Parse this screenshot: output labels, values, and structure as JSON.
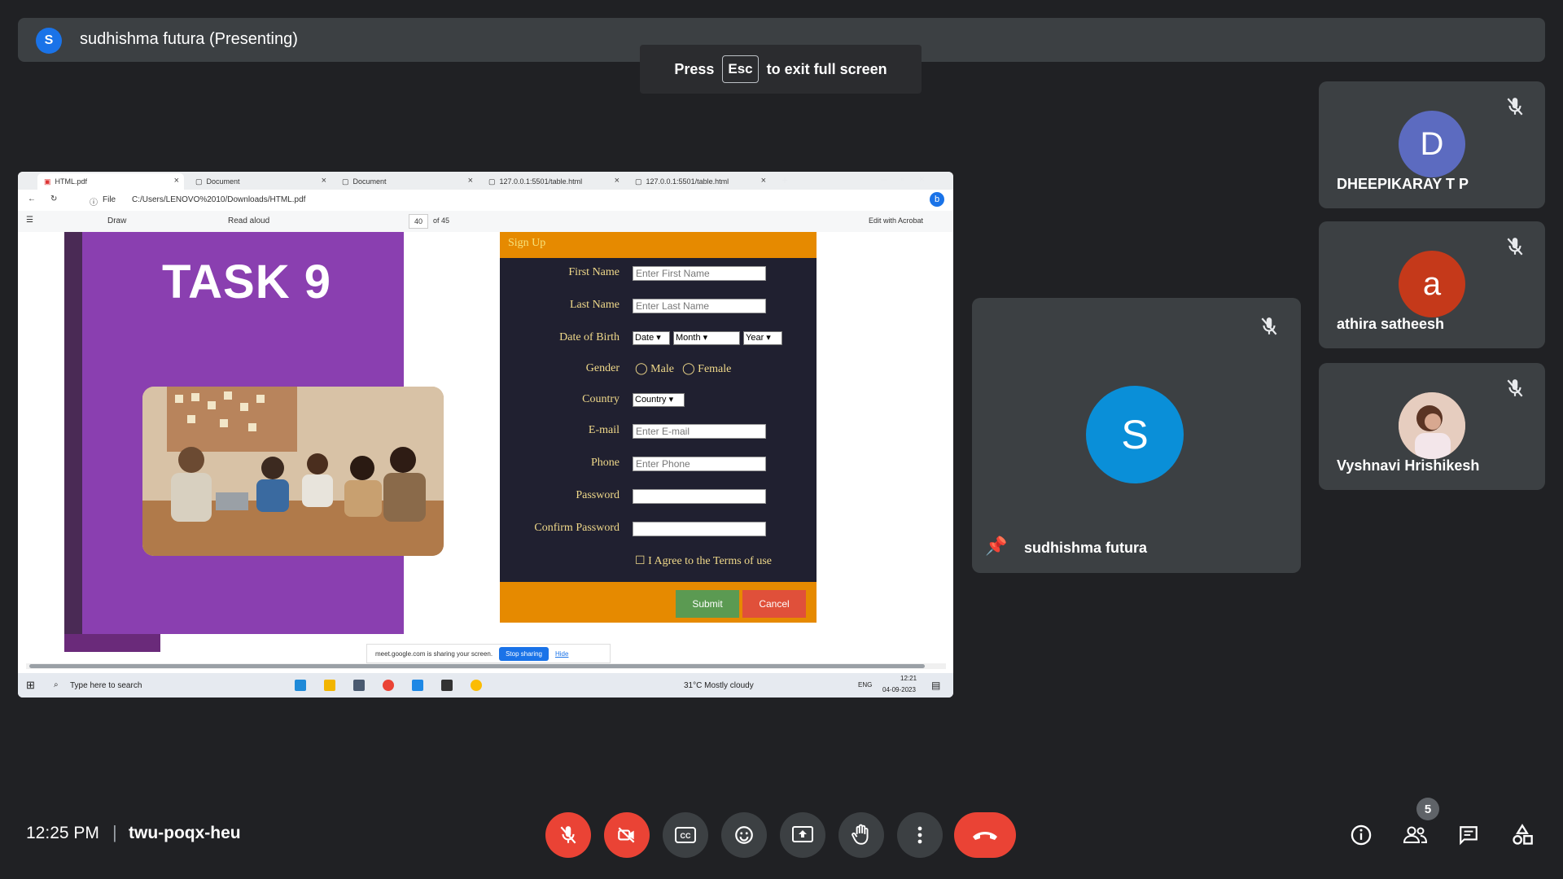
{
  "presenter_bar": {
    "avatar_letter": "S",
    "title": "sudhishma futura (Presenting)"
  },
  "esc_toast": {
    "press": "Press",
    "key": "Esc",
    "rest": "to exit full screen"
  },
  "browser": {
    "tabs": [
      "HTML.pdf",
      "Document",
      "Document",
      "127.0.0.1:5501/table.html",
      "127.0.0.1:5501/table.html"
    ],
    "address": "C:/Users/LENOVO%2010/Downloads/HTML.pdf",
    "file_label": "File",
    "toolbar": {
      "draw": "Draw",
      "read_aloud": "Read aloud",
      "page": "40",
      "of_pages": "of 45",
      "edit_acrobat": "Edit with Acrobat"
    }
  },
  "pdf": {
    "task_title": "TASK 9",
    "form": {
      "title": "Sign Up",
      "first_name": {
        "label": "First Name",
        "placeholder": "Enter First Name"
      },
      "last_name": {
        "label": "Last Name",
        "placeholder": "Enter Last Name"
      },
      "dob": {
        "label": "Date of Birth",
        "date": "Date",
        "month": "Month",
        "year": "Year"
      },
      "gender": {
        "label": "Gender",
        "male": "Male",
        "female": "Female"
      },
      "country": {
        "label": "Country",
        "value": "Country"
      },
      "email": {
        "label": "E-mail",
        "placeholder": "Enter E-mail"
      },
      "phone": {
        "label": "Phone",
        "placeholder": "Enter Phone"
      },
      "password": {
        "label": "Password"
      },
      "confirm_password": {
        "label": "Confirm Password"
      },
      "terms": "I Agree to the Terms of use",
      "submit": "Submit",
      "cancel": "Cancel"
    }
  },
  "share_banner": {
    "text": "meet.google.com is sharing your screen.",
    "stop": "Stop sharing",
    "hide": "Hide"
  },
  "taskbar": {
    "search": "Type here to search",
    "weather": "31°C  Mostly cloudy",
    "lang": "ENG",
    "time": "12:21",
    "date": "04-09-2023"
  },
  "participants": [
    {
      "letter": "D",
      "name": "DHEEPIKARAY T P",
      "color": "#5c6bc0"
    },
    {
      "letter": "a",
      "name": "athira satheesh",
      "color": "#c5391a"
    },
    {
      "letter": "",
      "name": "Vyshnavi Hrishikesh",
      "color": "#b07a6a"
    }
  ],
  "main_tile": {
    "letter": "S",
    "name": "sudhishma futura",
    "color": "#0a8fd8"
  },
  "bottom": {
    "time": "12:25 PM",
    "separator": "|",
    "meeting_code": "twu-poqx-heu",
    "people_count": "5"
  }
}
